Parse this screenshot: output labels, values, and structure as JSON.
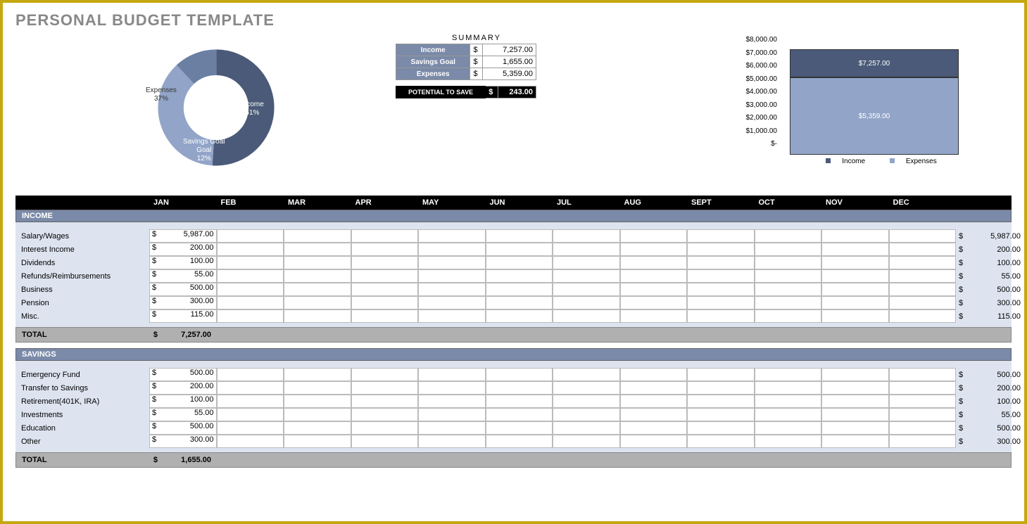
{
  "title": "PERSONAL BUDGET TEMPLATE",
  "summary": {
    "heading": "SUMMARY",
    "rows": [
      {
        "label": "Income",
        "currency": "$",
        "amount": "7,257.00"
      },
      {
        "label": "Savings Goal",
        "currency": "$",
        "amount": "1,655.00"
      },
      {
        "label": "Expenses",
        "currency": "$",
        "amount": "5,359.00"
      }
    ],
    "potential": {
      "label": "POTENTIAL TO SAVE",
      "currency": "$",
      "amount": "243.00"
    }
  },
  "donut": {
    "slices": [
      {
        "label": "Income",
        "pct": "51%"
      },
      {
        "label": "Expenses",
        "pct": "37%"
      },
      {
        "label": "Savings Goal",
        "pct": "12%"
      }
    ]
  },
  "axis_ticks": [
    "$8,000.00",
    "$7,000.00",
    "$6,000.00",
    "$5,000.00",
    "$4,000.00",
    "$3,000.00",
    "$2,000.00",
    "$1,000.00",
    "$-"
  ],
  "bar_chart": {
    "income_label": "$7,257.00",
    "expenses_label": "$5,359.00",
    "legend": {
      "income": "Income",
      "expenses": "Expenses"
    }
  },
  "months": [
    "JAN",
    "FEB",
    "MAR",
    "APR",
    "MAY",
    "JUN",
    "JUL",
    "AUG",
    "SEPT",
    "OCT",
    "NOV",
    "DEC"
  ],
  "sections": [
    {
      "name": "INCOME",
      "rows": [
        {
          "label": "Salary/Wages",
          "jan": "5,987.00",
          "total": "5,987.00"
        },
        {
          "label": "Interest Income",
          "jan": "200.00",
          "total": "200.00"
        },
        {
          "label": "Dividends",
          "jan": "100.00",
          "total": "100.00"
        },
        {
          "label": "Refunds/Reimbursements",
          "jan": "55.00",
          "total": "55.00"
        },
        {
          "label": "Business",
          "jan": "500.00",
          "total": "500.00"
        },
        {
          "label": "Pension",
          "jan": "300.00",
          "total": "300.00"
        },
        {
          "label": "Misc.",
          "jan": "115.00",
          "total": "115.00"
        }
      ],
      "total": {
        "label": "TOTAL",
        "amount": "7,257.00"
      }
    },
    {
      "name": "SAVINGS",
      "rows": [
        {
          "label": "Emergency Fund",
          "jan": "500.00",
          "total": "500.00"
        },
        {
          "label": "Transfer to Savings",
          "jan": "200.00",
          "total": "200.00"
        },
        {
          "label": "Retirement(401K, IRA)",
          "jan": "100.00",
          "total": "100.00"
        },
        {
          "label": "Investments",
          "jan": "55.00",
          "total": "55.00"
        },
        {
          "label": "Education",
          "jan": "500.00",
          "total": "500.00"
        },
        {
          "label": "Other",
          "jan": "300.00",
          "total": "300.00"
        }
      ],
      "total": {
        "label": "TOTAL",
        "amount": "1,655.00"
      }
    }
  ],
  "chart_data": [
    {
      "type": "pie",
      "title": "",
      "series": [
        {
          "name": "Income",
          "value": 51
        },
        {
          "name": "Expenses",
          "value": 37
        },
        {
          "name": "Savings Goal",
          "value": 12
        }
      ]
    },
    {
      "type": "bar",
      "categories": [
        ""
      ],
      "series": [
        {
          "name": "Income",
          "values": [
            7257.0
          ]
        },
        {
          "name": "Expenses",
          "values": [
            5359.0
          ]
        }
      ],
      "ylim": [
        0,
        8000
      ],
      "ylabel": "",
      "xlabel": ""
    }
  ]
}
